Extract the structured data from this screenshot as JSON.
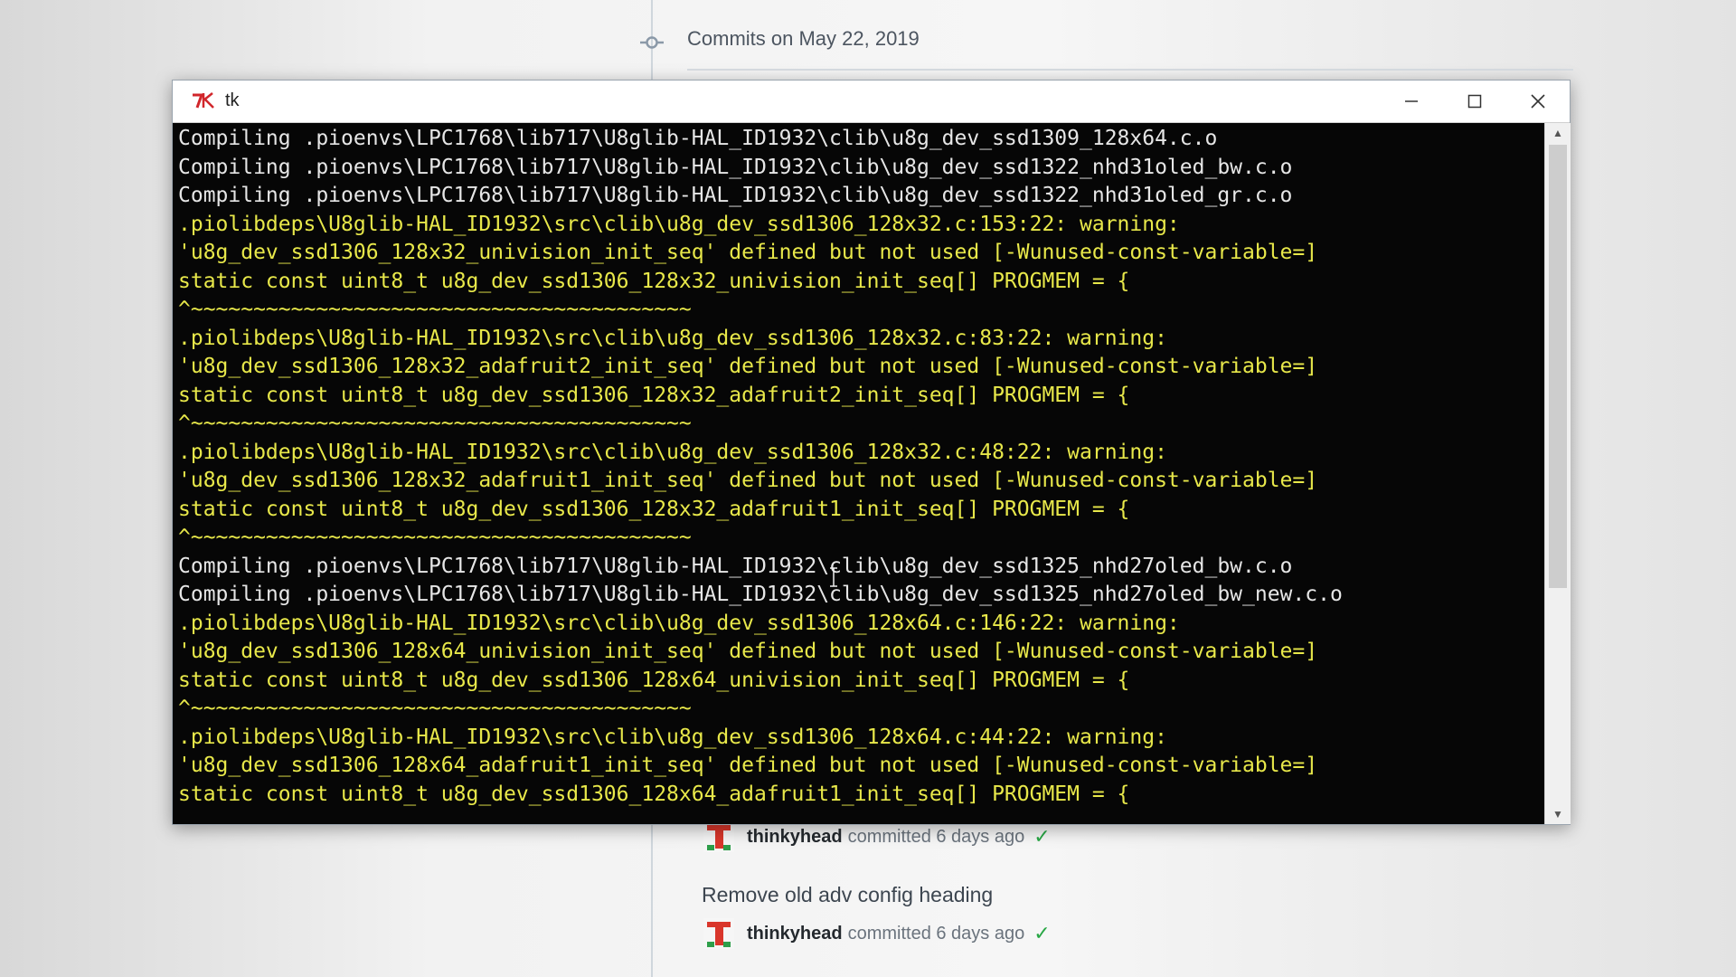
{
  "background_page": {
    "commit_group_title": "Commits on May 22, 2019",
    "commits": [
      {
        "author": "thinkyhead",
        "committed_text": "committed 6 days ago",
        "status": "success"
      },
      {
        "message": "Remove old adv config heading",
        "author": "thinkyhead",
        "committed_text": "committed 6 days ago",
        "status": "success"
      }
    ]
  },
  "window": {
    "title": "tk",
    "icon": "tk-feather-icon",
    "controls": {
      "minimize_icon": "minimize-icon",
      "maximize_icon": "maximize-icon",
      "close_icon": "close-icon"
    }
  },
  "console": {
    "colors": {
      "background": "#060606",
      "normal_text": "#e6e6e6",
      "warning_text": "#e8e84a"
    },
    "lines": [
      {
        "text": "Compiling .pioenvs\\LPC1768\\lib717\\U8glib-HAL_ID1932\\clib\\u8g_dev_ssd1309_128x64.c.o",
        "style": "white"
      },
      {
        "text": "Compiling .pioenvs\\LPC1768\\lib717\\U8glib-HAL_ID1932\\clib\\u8g_dev_ssd1322_nhd31oled_bw.c.o",
        "style": "white"
      },
      {
        "text": "Compiling .pioenvs\\LPC1768\\lib717\\U8glib-HAL_ID1932\\clib\\u8g_dev_ssd1322_nhd31oled_gr.c.o",
        "style": "white"
      },
      {
        "text": ".piolibdeps\\U8glib-HAL_ID1932\\src\\clib\\u8g_dev_ssd1306_128x32.c:153:22: warning:",
        "style": "yellow"
      },
      {
        "text": "'u8g_dev_ssd1306_128x32_univision_init_seq' defined but not used [-Wunused-const-variable=]",
        "style": "yellow"
      },
      {
        "text": "static const uint8_t u8g_dev_ssd1306_128x32_univision_init_seq[] PROGMEM = {",
        "style": "yellow"
      },
      {
        "text": "^~~~~~~~~~~~~~~~~~~~~~~~~~~~~~~~~~~~~~~~~",
        "style": "yellow"
      },
      {
        "text": ".piolibdeps\\U8glib-HAL_ID1932\\src\\clib\\u8g_dev_ssd1306_128x32.c:83:22: warning:",
        "style": "yellow"
      },
      {
        "text": "'u8g_dev_ssd1306_128x32_adafruit2_init_seq' defined but not used [-Wunused-const-variable=]",
        "style": "yellow"
      },
      {
        "text": "static const uint8_t u8g_dev_ssd1306_128x32_adafruit2_init_seq[] PROGMEM = {",
        "style": "yellow"
      },
      {
        "text": "^~~~~~~~~~~~~~~~~~~~~~~~~~~~~~~~~~~~~~~~~",
        "style": "yellow"
      },
      {
        "text": ".piolibdeps\\U8glib-HAL_ID1932\\src\\clib\\u8g_dev_ssd1306_128x32.c:48:22: warning:",
        "style": "yellow"
      },
      {
        "text": "'u8g_dev_ssd1306_128x32_adafruit1_init_seq' defined but not used [-Wunused-const-variable=]",
        "style": "yellow"
      },
      {
        "text": "static const uint8_t u8g_dev_ssd1306_128x32_adafruit1_init_seq[] PROGMEM = {",
        "style": "yellow"
      },
      {
        "text": "^~~~~~~~~~~~~~~~~~~~~~~~~~~~~~~~~~~~~~~~~",
        "style": "yellow"
      },
      {
        "text": "Compiling .pioenvs\\LPC1768\\lib717\\U8glib-HAL_ID1932\\clib\\u8g_dev_ssd1325_nhd27oled_bw.c.o",
        "style": "white"
      },
      {
        "text": "Compiling .pioenvs\\LPC1768\\lib717\\U8glib-HAL_ID1932\\clib\\u8g_dev_ssd1325_nhd27oled_bw_new.c.o",
        "style": "white"
      },
      {
        "text": ".piolibdeps\\U8glib-HAL_ID1932\\src\\clib\\u8g_dev_ssd1306_128x64.c:146:22: warning:",
        "style": "yellow"
      },
      {
        "text": "'u8g_dev_ssd1306_128x64_univision_init_seq' defined but not used [-Wunused-const-variable=]",
        "style": "yellow"
      },
      {
        "text": "static const uint8_t u8g_dev_ssd1306_128x64_univision_init_seq[] PROGMEM = {",
        "style": "yellow"
      },
      {
        "text": "^~~~~~~~~~~~~~~~~~~~~~~~~~~~~~~~~~~~~~~~~",
        "style": "yellow"
      },
      {
        "text": ".piolibdeps\\U8glib-HAL_ID1932\\src\\clib\\u8g_dev_ssd1306_128x64.c:44:22: warning:",
        "style": "yellow"
      },
      {
        "text": "'u8g_dev_ssd1306_128x64_adafruit1_init_seq' defined but not used [-Wunused-const-variable=]",
        "style": "yellow"
      },
      {
        "text": "static const uint8_t u8g_dev_ssd1306_128x64_adafruit1_init_seq[] PROGMEM = {",
        "style": "yellow"
      }
    ]
  }
}
